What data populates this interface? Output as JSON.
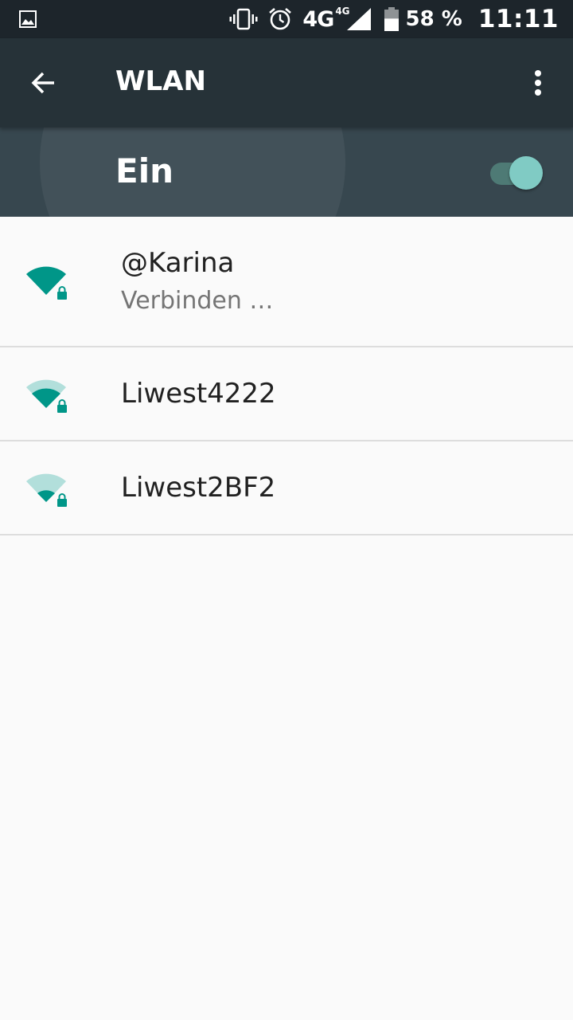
{
  "status_bar": {
    "icons": [
      "gallery-icon",
      "vibrate-icon",
      "alarm-icon",
      "signal-icon",
      "battery-icon"
    ],
    "network_type": "4G",
    "network_sub": "4G",
    "battery_percent": "58 %",
    "battery_level": 0.58,
    "time": "11:11"
  },
  "toolbar": {
    "title": "WLAN",
    "back_icon": "arrow-back-icon",
    "menu_icon": "more-vert-icon"
  },
  "switch_bar": {
    "label": "Ein",
    "checked": true
  },
  "networks": [
    {
      "ssid": "@Karina",
      "summary": "Verbinden …",
      "signal_level": 4,
      "secured": true
    },
    {
      "ssid": "Liwest4222",
      "summary": "",
      "signal_level": 3,
      "secured": true
    },
    {
      "ssid": "Liwest2BF2",
      "summary": "",
      "signal_level": 2,
      "secured": true
    }
  ],
  "colors": {
    "status_bar": "#1d252b",
    "toolbar": "#263238",
    "switch_bar": "#37474f",
    "accent": "#009688",
    "accent_light": "#b2dfdb",
    "background": "#fafafa"
  }
}
